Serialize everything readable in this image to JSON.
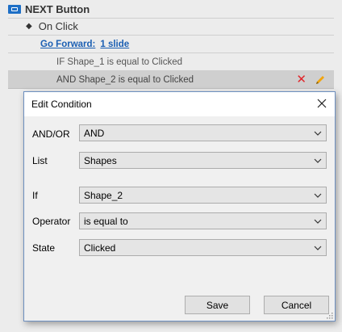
{
  "panel": {
    "trigger_title": "NEXT Button",
    "event_label": "On Click",
    "action_label": "Go Forward:",
    "action_target": "1 slide",
    "condition_1": "IF Shape_1 is equal to Clicked",
    "condition_2": "AND Shape_2 is equal to Clicked"
  },
  "dialog": {
    "title": "Edit Condition",
    "fields": {
      "andor": {
        "label": "AND/OR",
        "value": "AND"
      },
      "list": {
        "label": "List",
        "value": "Shapes"
      },
      "if": {
        "label": "If",
        "value": "Shape_2"
      },
      "operator": {
        "label": "Operator",
        "value": "is equal to"
      },
      "state": {
        "label": "State",
        "value": "Clicked"
      }
    },
    "save_label": "Save",
    "cancel_label": "Cancel"
  },
  "colors": {
    "link": "#1b5fb3",
    "delete": "#e0262b",
    "edit": "#f2a40c",
    "button_icon": "#1e6fc6"
  },
  "icons": [
    "button-trigger-icon",
    "diamond-icon",
    "delete-icon",
    "pencil-icon",
    "close-icon",
    "chevron-down-icon",
    "resize-grip-icon"
  ]
}
